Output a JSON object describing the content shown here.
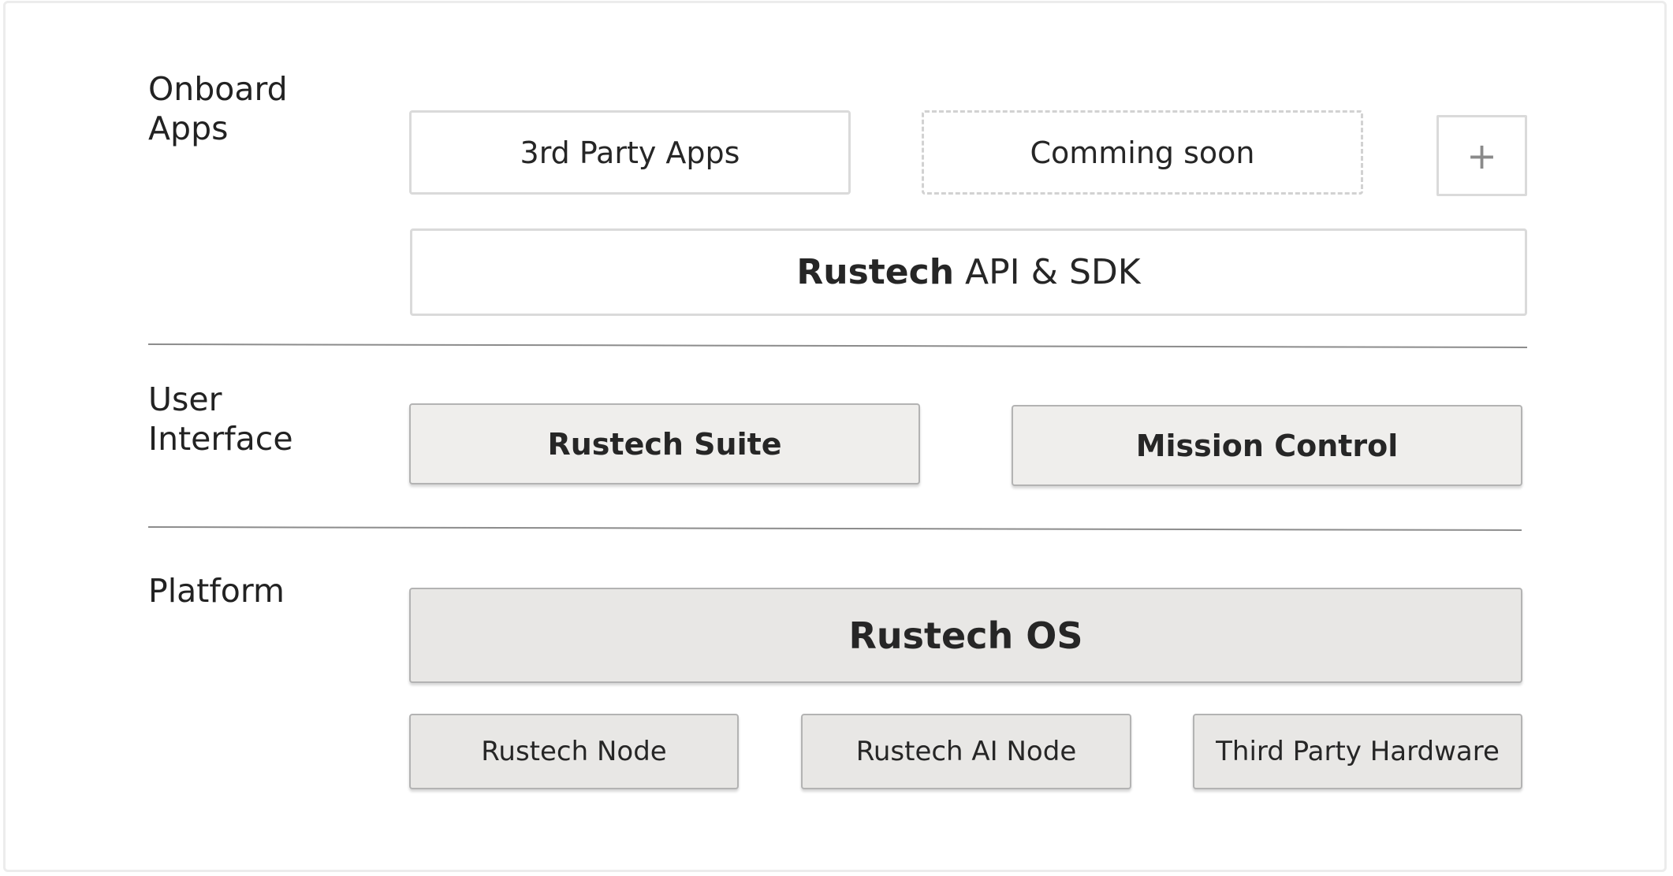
{
  "sections": {
    "onboard_apps": {
      "label": "Onboard\nApps"
    },
    "user_interface": {
      "label": "User\nInterface"
    },
    "platform": {
      "label": "Platform"
    }
  },
  "onboard": {
    "third_party_apps": "3rd Party Apps",
    "coming_soon": "Comming soon",
    "plus": "+",
    "api_brand": "Rustech",
    "api_rest": " API & SDK"
  },
  "ui": {
    "suite": "Rustech Suite",
    "mission_control": "Mission Control"
  },
  "platform": {
    "os": "Rustech OS",
    "node": "Rustech Node",
    "ai_node": "Rustech AI Node",
    "third_party_hardware": "Third Party Hardware"
  }
}
